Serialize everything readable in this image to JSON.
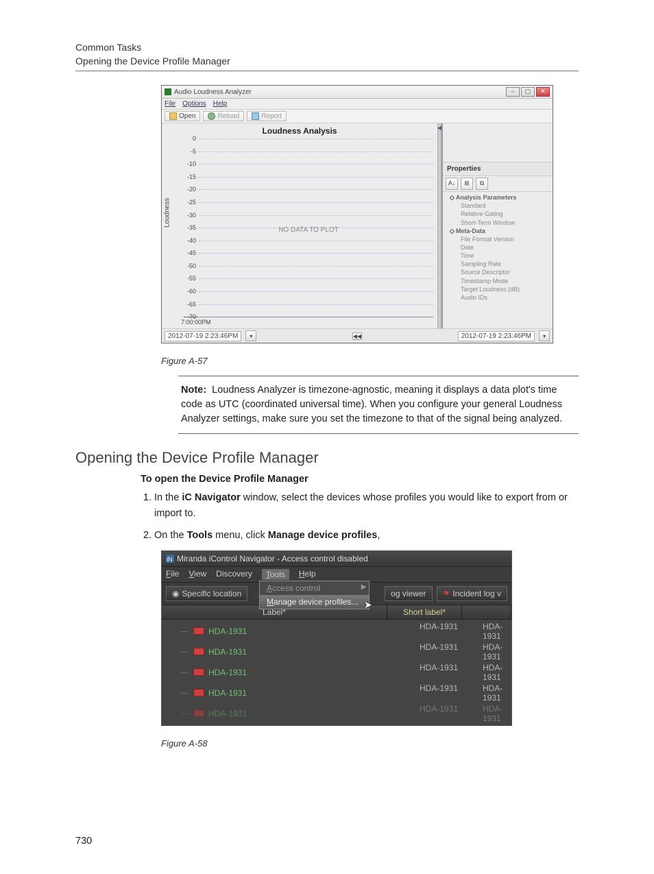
{
  "header": {
    "line1": "Common Tasks",
    "line2": "Opening the Device Profile Manager"
  },
  "figA57": {
    "title": "Audio Loudness Analyzer",
    "menu": {
      "file": "File",
      "options": "Options",
      "help": "Help"
    },
    "toolbar": {
      "open": "Open",
      "reload": "Reload",
      "report": "Report"
    },
    "chart": {
      "title": "Loudness Analysis",
      "ylabel": "Loudness",
      "no_data": "NO DATA TO PLOT",
      "x_time": "7:00:00PM"
    },
    "timebar": {
      "t1": "2012-07-19 2:23:46PM",
      "t2": "2012-07-19 2:23:46PM"
    },
    "props": {
      "header": "Properties",
      "g1": "Analysis Parameters",
      "g1_items": [
        "Standard",
        "Relative Gating",
        "Short-Term Window"
      ],
      "g2": "Meta-Data",
      "g2_items": [
        "File Format Version",
        "Date",
        "Time",
        "Sampling Rate",
        "Source Descriptor",
        "Timestamp Mode",
        "Target Loudness (dB)",
        "Audio IDs"
      ]
    },
    "caption": "Figure A-57"
  },
  "note": {
    "label": "Note:",
    "body": "Loudness Analyzer is timezone-agnostic, meaning it displays a data plot's time code as UTC (coordinated universal time). When you configure your general Loudness Analyzer settings, make sure you set the timezone to that of the signal being analyzed."
  },
  "section_title": "Opening the Device Profile Manager",
  "subhead": "To open the Device Profile Manager",
  "steps": {
    "s1a": "In the ",
    "s1b": "iC Navigator",
    "s1c": " window, select the devices whose profiles you would like to export from or import to.",
    "s2a": "On the ",
    "s2b": "Tools",
    "s2c": " menu, click ",
    "s2d": "Manage device profiles",
    "s2e": ","
  },
  "figA58": {
    "title": "Miranda iControl Navigator - Access control disabled",
    "menu": {
      "file": "File",
      "view": "View",
      "discovery": "Discovery",
      "tools": "Tools",
      "help": "Help"
    },
    "specific": "Specific location",
    "tools_menu": {
      "ac": "Access control",
      "mdp": "Manage device profiles..."
    },
    "right_btn1": "og viewer",
    "right_btn2": "Incident log v",
    "cols": {
      "label": "Label*",
      "short": "Short label*"
    },
    "rows": [
      {
        "c1": "HDA-1931",
        "c2": "HDA-1931",
        "c3": "HDA-1931"
      },
      {
        "c1": "HDA-1931",
        "c2": "HDA-1931",
        "c3": "HDA-1931"
      },
      {
        "c1": "HDA-1931",
        "c2": "HDA-1931",
        "c3": "HDA-1931"
      },
      {
        "c1": "HDA-1931",
        "c2": "HDA-1931",
        "c3": "HDA-1931"
      }
    ],
    "dimrow": {
      "c1": "HDA-1931",
      "c2": "HDA-1931",
      "c3": "HDA-1931"
    },
    "caption": "Figure A-58"
  },
  "page_number": "730",
  "chart_data": {
    "type": "line",
    "title": "Loudness Analysis",
    "ylabel": "Loudness",
    "xlabel": "",
    "ylim": [
      -70,
      0
    ],
    "yticks": [
      0,
      -5,
      -10,
      -15,
      -20,
      -25,
      -30,
      -35,
      -40,
      -45,
      -50,
      -55,
      -60,
      -65,
      -70
    ],
    "x_start": "7:00:00PM",
    "series": [],
    "note": "NO DATA TO PLOT"
  }
}
